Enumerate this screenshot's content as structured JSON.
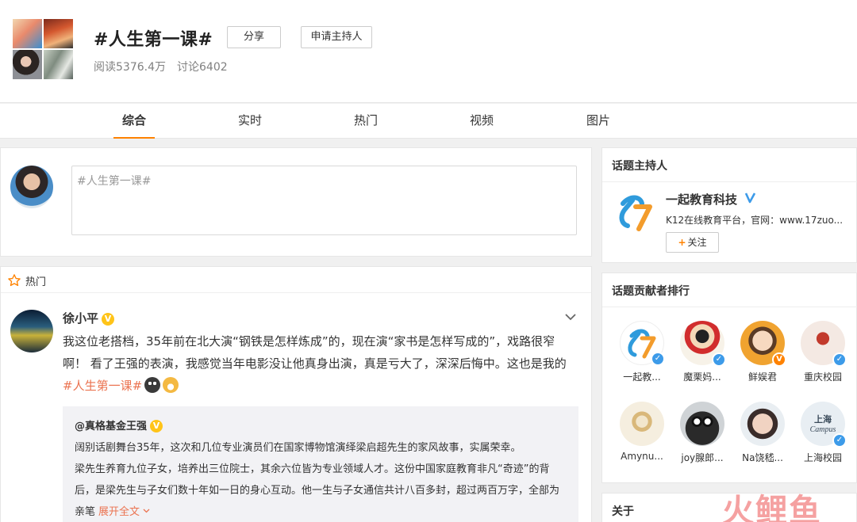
{
  "topic": {
    "title": "#人生第一课#",
    "share_label": "分享",
    "host_apply_label": "申请主持人",
    "reads": "阅读5376.4万",
    "discussions": "讨论6402"
  },
  "tabs": [
    {
      "label": "综合",
      "active": true
    },
    {
      "label": "实时",
      "active": false
    },
    {
      "label": "热门",
      "active": false
    },
    {
      "label": "视频",
      "active": false
    },
    {
      "label": "图片",
      "active": false
    }
  ],
  "compose": {
    "value": "#人生第一课#"
  },
  "feed": {
    "section_label": "热门",
    "post": {
      "author": "徐小平",
      "verified": "V",
      "text": "我这位老搭档，35年前在北大演“钢铁是怎样炼成”的，现在演“家书是怎样写成的”，戏路很窄啊！ 看了王强的表演，我感觉当年电影没让他真身出演，真是亏大了，深深后悔中。这也是我的",
      "hashtag": "#人生第一课#",
      "repost": {
        "author": "@真格基金王强",
        "verified": "V",
        "line1": "阔别话剧舞台35年，这次和几位专业演员们在国家博物馆演绎梁启超先生的家风故事，实属荣幸。",
        "line2": "梁先生养育九位子女，培养出三位院士，其余六位皆为专业领域人才。这份中国家庭教育非凡“奇迹”的背后，是梁先生与子女们数十年如一日的身心互动。他一生与子女通信共计八百多封，超过两百万字，全部为亲笔",
        "expand_label": "展开全文"
      }
    }
  },
  "host_panel": {
    "title": "话题主持人",
    "name": "一起教育科技",
    "desc": "K12在线教育平台，官网：www.17zuo...",
    "follow_label": "关注",
    "follow_plus": "+"
  },
  "contributors": {
    "title": "话题贡献者排行",
    "items": [
      {
        "name": "一起教...",
        "badge": "blue"
      },
      {
        "name": "魔栗妈...",
        "badge": "blue"
      },
      {
        "name": "鲜娱君",
        "badge": "orange"
      },
      {
        "name": "重庆校园",
        "badge": "blue"
      },
      {
        "name": "Amynu...",
        "badge": "none"
      },
      {
        "name": "joy腺郎...",
        "badge": "none"
      },
      {
        "name": "Na饶嵇...",
        "badge": "none"
      },
      {
        "name": "上海校园",
        "badge": "blue"
      }
    ]
  },
  "about": {
    "title": "关于"
  },
  "watermark": "火鲤鱼",
  "colors": {
    "accent": "#ff8200",
    "hashtag": "#eb7350",
    "verified_blue": "#3d9be9",
    "verified_gold": "#ffc419"
  }
}
